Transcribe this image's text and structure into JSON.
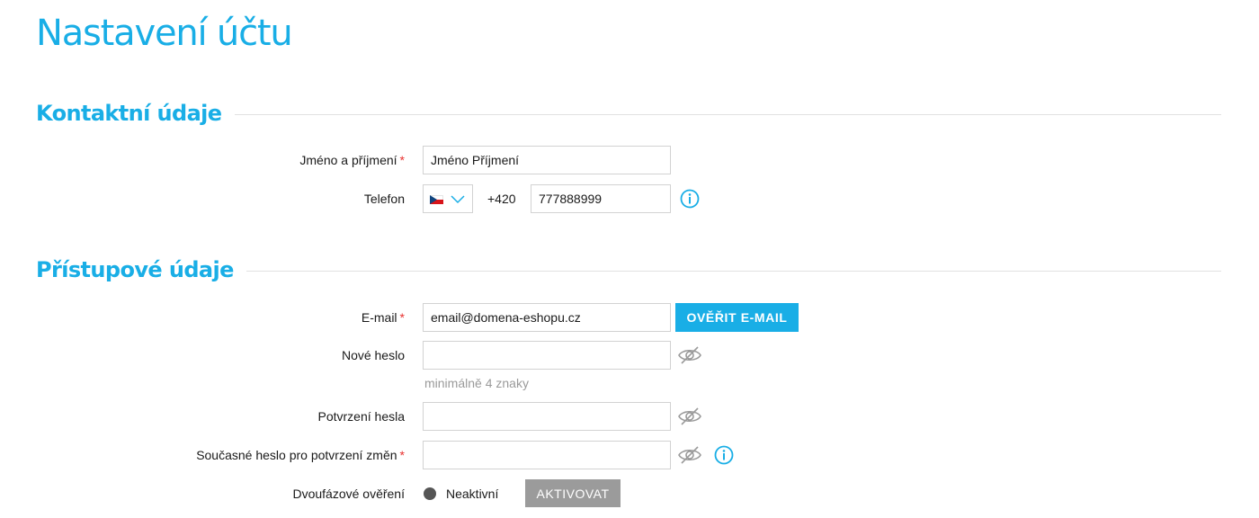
{
  "colors": {
    "accent": "#19aee6",
    "required": "#e8312f",
    "muted": "#9a9a9a",
    "button_gray": "#9b9b9b"
  },
  "page": {
    "title": "Nastavení účtu"
  },
  "contact": {
    "title": "Kontaktní údaje",
    "name": {
      "label": "Jméno a příjmení",
      "required_mark": "*",
      "value": "Jméno Příjmení"
    },
    "phone": {
      "label": "Telefon",
      "country_flag": "flag-cz-icon",
      "prefix": "+420",
      "value": "777888999",
      "info_icon": "info-icon"
    }
  },
  "access": {
    "title": "Přístupové údaje",
    "email": {
      "label": "E-mail",
      "required_mark": "*",
      "value": "email@domena-eshopu.cz",
      "verify_button": "OVĚŘIT E-MAIL"
    },
    "new_password": {
      "label": "Nové heslo",
      "value": "",
      "hint": "minimálně 4 znaky",
      "toggle_icon": "eye-slash-icon"
    },
    "confirm_password": {
      "label": "Potvrzení hesla",
      "value": "",
      "toggle_icon": "eye-slash-icon"
    },
    "current_password": {
      "label": "Současné heslo pro potvrzení změn",
      "required_mark": "*",
      "value": "",
      "toggle_icon": "eye-slash-icon",
      "info_icon": "info-icon"
    },
    "two_factor": {
      "label": "Dvoufázové ověření",
      "status": "Neaktivní",
      "activate_button": "AKTIVOVAT"
    }
  }
}
